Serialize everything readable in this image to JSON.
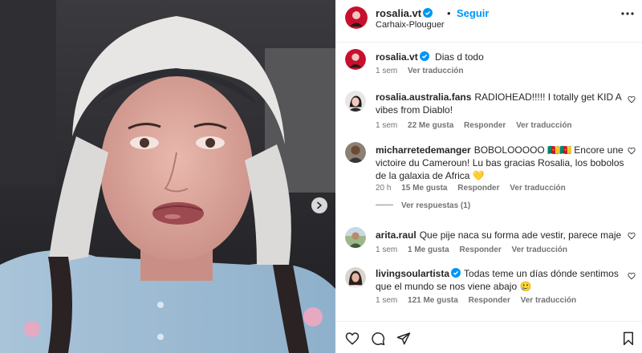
{
  "header": {
    "username": "rosalia.vt",
    "separator": "•",
    "follow_label": "Seguir",
    "location": "Carhaix-Plouguer"
  },
  "comments": [
    {
      "username": "rosalia.vt",
      "verified": true,
      "text": "Dias d todo",
      "time": "1 sem",
      "likes": "",
      "reply_label": "",
      "translate_label": "Ver traducción",
      "avatar": "red-avatar"
    },
    {
      "username": "rosalia.australia.fans",
      "verified": false,
      "text": "RADIOHEAD!!!!! I totally get KID A vibes from Diablo!",
      "time": "1 sem",
      "likes": "22 Me gusta",
      "reply_label": "Responder",
      "translate_label": "Ver traducción",
      "avatar": "portrait-avatar"
    },
    {
      "username": "micharretedemanger",
      "verified": false,
      "text": "BOBOLOOOOO 🇨🇲🇨🇲 Encore une victoire du Cameroun! Lu bas gracias Rosalia, los bobolos de la galaxia de Africa 💛",
      "time": "20 h",
      "likes": "15 Me gusta",
      "reply_label": "Responder",
      "translate_label": "Ver traducción",
      "avatar": "man-avatar",
      "view_replies": "Ver respuestas (1)"
    },
    {
      "username": "arita.raul",
      "verified": false,
      "text": "Que pije naca su forma ade vestir, parece maje",
      "time": "1 sem",
      "likes": "1 Me gusta",
      "reply_label": "Responder",
      "translate_label": "Ver traducción",
      "avatar": "outdoor-avatar"
    },
    {
      "username": "livingsoulartista",
      "verified": true,
      "text": "Todas teme un días dónde sentimos que el mundo se nos viene abajo 🥲",
      "time": "1 sem",
      "likes": "121 Me gusta",
      "reply_label": "Responder",
      "translate_label": "Ver traducción",
      "avatar": "woman-avatar"
    }
  ],
  "icons": {
    "like": "heart-icon",
    "comment": "comment-icon",
    "share": "share-icon",
    "save": "bookmark-icon",
    "more": "more-options-icon",
    "verified": "verified-badge-icon",
    "next": "chevron-right-icon"
  },
  "colors": {
    "accent": "#0095f6",
    "text": "#262626",
    "muted": "#737373",
    "divider": "#efefef"
  }
}
